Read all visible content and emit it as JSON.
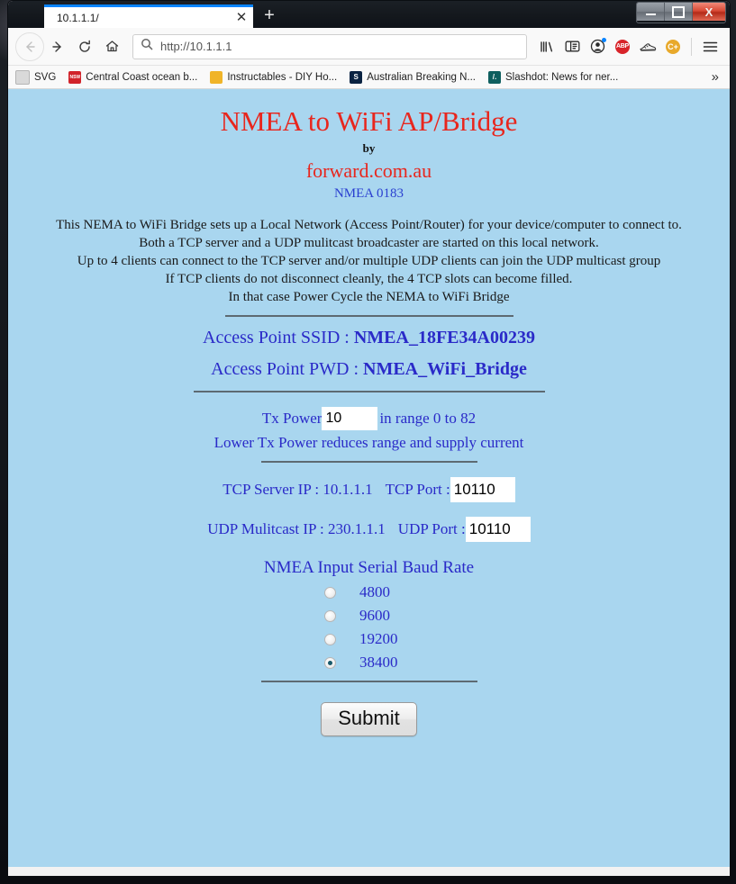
{
  "browser": {
    "tab": {
      "title": "10.1.1.1/",
      "close_label": "✕"
    },
    "new_tab_label": "+",
    "window_controls": {
      "minimize": "minimize-icon",
      "maximize": "maximize-icon",
      "close": "X"
    },
    "nav": {
      "back": "back-arrow-icon",
      "forward": "forward-arrow-icon",
      "reload": "reload-icon",
      "home": "home-icon",
      "url_scheme": "http://",
      "url_host": "10.1.1.1",
      "url_full": "http://10.1.1.1",
      "search_icon": "search-icon"
    },
    "toolbar_icons": [
      {
        "name": "library-icon",
        "label": "lll\\"
      },
      {
        "name": "sidebar-icon",
        "label": ""
      },
      {
        "name": "account-icon",
        "label": ""
      },
      {
        "name": "adblock-plus-icon",
        "label": "ABP"
      },
      {
        "name": "sneaker-extension-icon",
        "label": ""
      },
      {
        "name": "c-plus-extension-icon",
        "label": "C+"
      },
      {
        "name": "hamburger-menu-icon",
        "label": "≡"
      }
    ],
    "bookmarks": [
      {
        "label": "SVG",
        "icon": "folder-icon",
        "icon_text": "",
        "icon_color": "#cfcfcf"
      },
      {
        "label": "Central Coast ocean b...",
        "icon": "nsw-icon",
        "icon_text": "NSW",
        "icon_color": "#d1232a"
      },
      {
        "label": "Instructables - DIY Ho...",
        "icon": "instructables-icon",
        "icon_text": "",
        "icon_color": "#f0b429"
      },
      {
        "label": "Australian Breaking N...",
        "icon": "smh-icon",
        "icon_text": "S",
        "icon_color": "#0a2342"
      },
      {
        "label": "Slashdot: News for ner...",
        "icon": "slashdot-icon",
        "icon_text": "/.",
        "icon_color": "#0f5f5f"
      }
    ],
    "bookmarks_overflow": "»"
  },
  "page": {
    "title": "NMEA to WiFi AP/Bridge",
    "by": "by",
    "brand": "forward.com.au",
    "standard": "NMEA 0183",
    "description": [
      "This NEMA to WiFi Bridge sets up a Local Network (Access Point/Router) for your device/computer to connect to.",
      "Both a TCP server and a UDP mulitcast broadcaster are started on this local network.",
      "Up to 4 clients can connect to the TCP server and/or multiple UDP clients can join the UDP multicast group",
      "If TCP clients do not disconnect cleanly, the 4 TCP slots can become filled.",
      "In that case Power Cycle the NEMA to WiFi Bridge"
    ],
    "access_point": {
      "ssid_label": "Access Point SSID : ",
      "ssid_value": "NMEA_18FE34A00239",
      "pwd_label": "Access Point PWD : ",
      "pwd_value": "NMEA_WiFi_Bridge"
    },
    "tx_power": {
      "label": "Tx Power",
      "value": "10",
      "range_text": "in range 0 to 82",
      "note": "Lower Tx Power reduces range and supply current"
    },
    "network": {
      "tcp_ip_label": "TCP Server IP : 10.1.1.1",
      "tcp_port_label": "TCP Port : ",
      "tcp_port_value": "10110",
      "udp_ip_label": "UDP Mulitcast IP : 230.1.1.1",
      "udp_port_label": "UDP Port : ",
      "udp_port_value": "10110"
    },
    "baud": {
      "title": "NMEA Input Serial Baud Rate",
      "options": [
        {
          "label": "4800",
          "selected": false
        },
        {
          "label": "9600",
          "selected": false
        },
        {
          "label": "19200",
          "selected": false
        },
        {
          "label": "38400",
          "selected": true
        }
      ]
    },
    "submit_label": "Submit",
    "colors": {
      "background": "#a9d6ef",
      "heading_red": "#e8261d",
      "link_blue": "#2a2ac8",
      "text_black": "#1a1a1a"
    }
  }
}
